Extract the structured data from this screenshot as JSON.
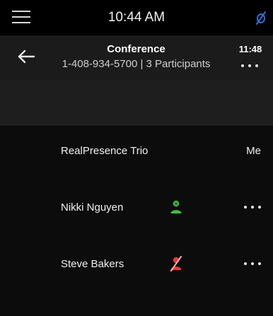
{
  "status_bar": {
    "time": "10:44 AM",
    "menu_icon": "hamburger-menu-icon",
    "status_icon": "blue-slash-status-icon",
    "status_icon_color": "#2f6fd6"
  },
  "call": {
    "title": "Conference",
    "subtitle": "1-408-934-5700 | 3 Participants",
    "timer": "11:48",
    "back_icon": "back-arrow-icon",
    "more_icon": "more-options-icon"
  },
  "participants": [
    {
      "name": "RealPresence Trio",
      "tag": "Me"
    },
    {
      "name": "Nikki Nguyen",
      "status_icon": "unmuted-participant-icon",
      "status_color": "#3fbf3f",
      "more_icon": "more-options-icon"
    },
    {
      "name": "Steve Bakers",
      "status_icon": "muted-participant-icon",
      "status_color": "#e23a3a",
      "more_icon": "more-options-icon"
    }
  ]
}
